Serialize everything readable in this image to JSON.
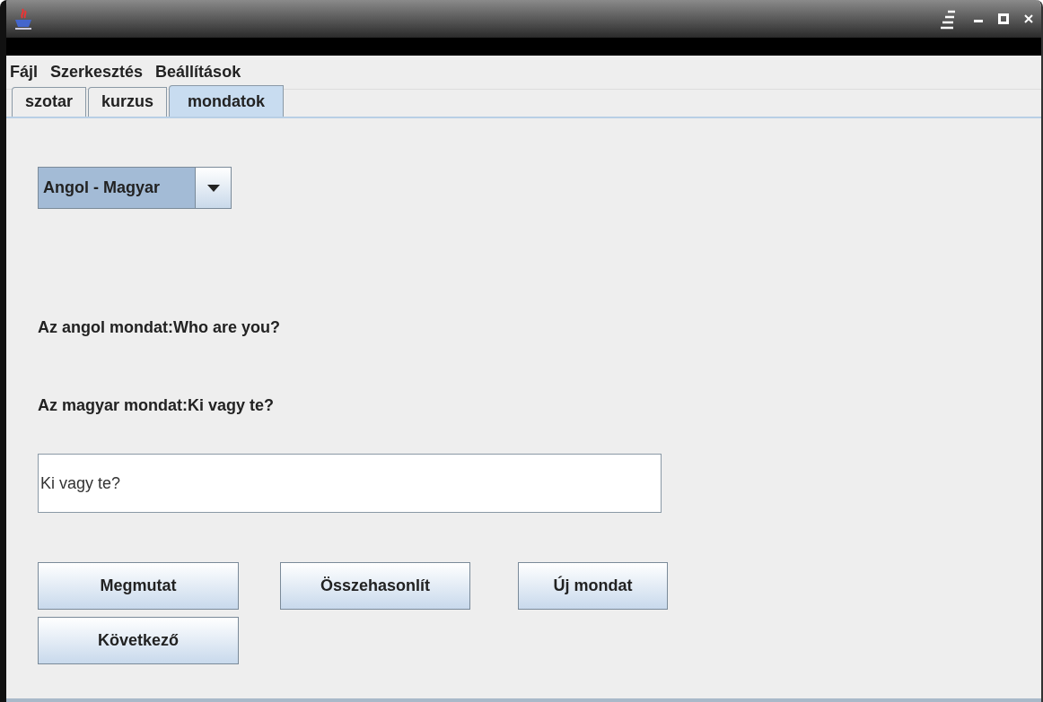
{
  "menu": [
    "Fájl",
    "Szerkesztés",
    "Beállítások"
  ],
  "tabs": [
    {
      "label": "szotar",
      "selected": false
    },
    {
      "label": "kurzus",
      "selected": false
    },
    {
      "label": "mondatok",
      "selected": true
    }
  ],
  "combo": {
    "value": "Angol - Magyar"
  },
  "labels": [
    "Az angol mondat:Who are you?",
    "Az magyar mondat:Ki vagy te?"
  ],
  "answer": {
    "value": "Ki vagy te?"
  },
  "buttons": [
    [
      "Megmutat",
      "Összehasonlít",
      "Új mondat"
    ],
    [
      "Következő"
    ]
  ]
}
